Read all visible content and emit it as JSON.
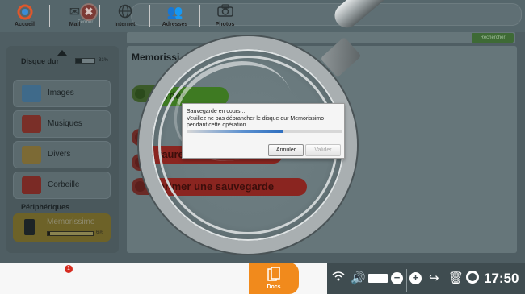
{
  "header": {
    "close_label": "Fermer",
    "close_symbol": "✖"
  },
  "search": {
    "button_label": "Rechercher"
  },
  "sidebar": {
    "disk_label": "Disque dur",
    "disk_usage": "31%",
    "disk_usage_fraction": 0.31,
    "items": [
      {
        "label": "Images",
        "icon": "images-icon",
        "color": "#3f6a8a"
      },
      {
        "label": "Musiques",
        "icon": "music-icon",
        "color": "#7a2f28"
      },
      {
        "label": "Divers",
        "icon": "folder-icon",
        "color": "#7c6a35"
      },
      {
        "label": "Corbeille",
        "icon": "trash-icon",
        "color": "#7a2a25"
      }
    ],
    "peripherals_label": "Périphériques",
    "device": {
      "label": "Memorissimo",
      "usage": "6%",
      "usage_fraction": 0.06
    }
  },
  "main": {
    "title": "Memorissi",
    "save_label": "garder",
    "actions": [
      {
        "label": "taurer un document"
      },
      {
        "label": "primer une sauvegarde"
      }
    ]
  },
  "dialog": {
    "line1": "Sauvegarde en cours...",
    "line2": "Veuillez ne pas débrancher le disque dur Memorissimo",
    "line3": "pendant cette opération.",
    "progress_fraction": 0.62,
    "cancel_label": "Annuler",
    "confirm_label": "Valider"
  },
  "taskbar": {
    "items": [
      {
        "label": "Accueil",
        "icon": "home-icon"
      },
      {
        "label": "Mail",
        "icon": "mail-icon"
      },
      {
        "label": "Internet",
        "icon": "globe-icon"
      },
      {
        "label": "Adresses",
        "icon": "contacts-icon"
      },
      {
        "label": "Photos",
        "icon": "camera-icon"
      },
      {
        "label": "Docs",
        "icon": "docs-icon"
      }
    ],
    "mail_badge": "1",
    "clock": "17:50"
  },
  "colors": {
    "accent": "#f18a1c",
    "save_green": "#3e7a22",
    "danger_red": "#8a2520",
    "status_bar": "#3f4c50"
  }
}
